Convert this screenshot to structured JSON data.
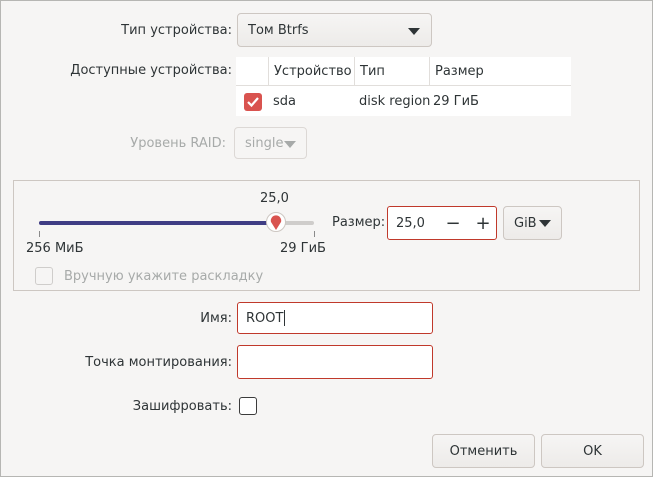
{
  "device_type": {
    "label": "Тип устройства:",
    "value": "Том Btrfs"
  },
  "available_devices": {
    "label": "Доступные устройства:",
    "columns": [
      "Устройство",
      "Тип",
      "Размер"
    ],
    "rows": [
      {
        "checked": true,
        "device": "sda",
        "type": "disk region",
        "size": "29 ГиБ"
      }
    ]
  },
  "raid": {
    "label": "Уровень RAID:",
    "value": "single",
    "enabled": false
  },
  "size_slider": {
    "value_label": "25,0",
    "min_label": "256 МиБ",
    "max_label": "29 ГиБ",
    "fraction": 0.86
  },
  "size": {
    "label": "Размер:",
    "value": "25,0",
    "minus": "−",
    "plus": "+",
    "unit": "GiB"
  },
  "manual_layout": {
    "label": "Вручную укажите раскладку",
    "enabled": false
  },
  "name": {
    "label": "Имя:",
    "value": "ROOT"
  },
  "mountpoint": {
    "label": "Точка монтирования:",
    "value": ""
  },
  "encrypt": {
    "label": "Зашифровать:",
    "checked": false
  },
  "buttons": {
    "cancel": "Отменить",
    "ok": "OK"
  },
  "colors": {
    "accent": "#d9534f",
    "error_border": "#c0392b",
    "slider_fill": "#3f3d84"
  }
}
